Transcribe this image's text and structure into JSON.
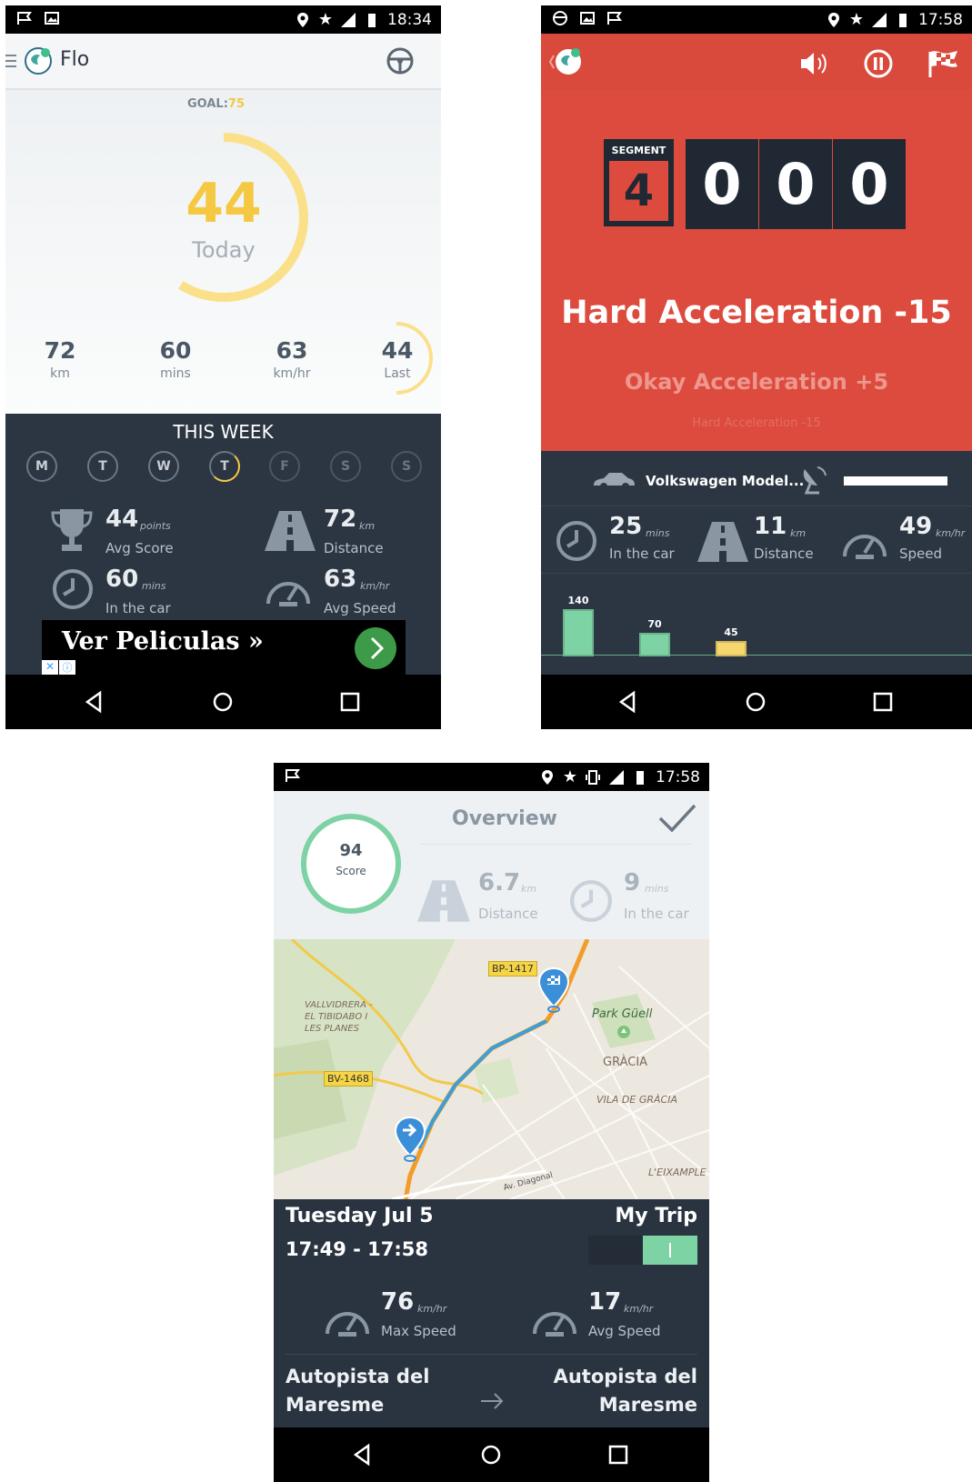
{
  "colors": {
    "accent_yellow": "#f5c842",
    "dark_panel": "#2c3643",
    "red": "#dc4b3e",
    "green": "#7ed3a5",
    "teal": "#3fb8a0"
  },
  "phone1": {
    "status": {
      "time": "18:34"
    },
    "app_title": "Flo",
    "goal_label": "GOAL:",
    "goal_value": "75",
    "today_score": "44",
    "today_label": "Today",
    "today_fraction": 0.59,
    "stats": [
      {
        "value": "72",
        "unit": "km"
      },
      {
        "value": "60",
        "unit": "mins"
      },
      {
        "value": "63",
        "unit": "km/hr"
      },
      {
        "value": "44",
        "unit": "Last"
      }
    ],
    "week_title": "THIS WEEK",
    "days": [
      "M",
      "T",
      "W",
      "T",
      "F",
      "S",
      "S"
    ],
    "week_stats": [
      {
        "value": "44",
        "unit": "points",
        "label": "Avg Score",
        "icon": "trophy-icon"
      },
      {
        "value": "72",
        "unit": "km",
        "label": "Distance",
        "icon": "road-icon"
      },
      {
        "value": "60",
        "unit": "mins",
        "label": "In the car",
        "icon": "clock-icon"
      },
      {
        "value": "63",
        "unit": "km/hr",
        "label": "Avg Speed",
        "icon": "speedometer-icon"
      }
    ],
    "ad_text": "Ver Peliculas »"
  },
  "phone2": {
    "status": {
      "time": "17:58"
    },
    "segment_label": "SEGMENT",
    "segment_value": "4",
    "digits": [
      "0",
      "0",
      "0"
    ],
    "event_main": "Hard Acceleration -15",
    "event_prev": "Okay Acceleration +5",
    "event_prev2": "Hard Acceleration -15",
    "car_name": "Volkswagen Model...",
    "stats": [
      {
        "value": "25",
        "unit": "mins",
        "label": "In the car",
        "icon": "clock-icon"
      },
      {
        "value": "11",
        "unit": "km",
        "label": "Distance",
        "icon": "road-icon"
      },
      {
        "value": "49",
        "unit": "km/hr",
        "label": "Speed",
        "icon": "speedometer-icon"
      }
    ],
    "speed_bars": [
      {
        "label": "140",
        "value": 140,
        "color": "#7ed3a5"
      },
      {
        "label": "70",
        "value": 70,
        "color": "#7ed3a5"
      },
      {
        "label": "45",
        "value": 45,
        "color": "#f5d76e"
      }
    ]
  },
  "phone3": {
    "status": {
      "time": "17:58"
    },
    "score": "94",
    "score_label": "Score",
    "overview_label": "Overview",
    "distance": {
      "value": "6.7",
      "unit": "km",
      "label": "Distance"
    },
    "time_in_car": {
      "value": "9",
      "unit": "mins",
      "label": "In the car"
    },
    "map_labels": [
      "BP-1417",
      "Park Güell",
      "GRÀCIA",
      "VILA DE GRÀCIA",
      "VALLVIDRERA - EL TIBIDABO I LES PLANES",
      "BV-1468",
      "L'EIXAMPLE",
      "Av. Diagonal"
    ],
    "date": "Tuesday Jul 5",
    "time_range": "17:49 - 17:58",
    "my_trip_label": "My Trip",
    "max_speed": {
      "value": "76",
      "unit": "km/hr",
      "label": "Max Speed"
    },
    "avg_speed": {
      "value": "17",
      "unit": "km/hr",
      "label": "Avg Speed"
    },
    "from": "Autopista del Maresme",
    "to": "Autopista del Maresme"
  }
}
